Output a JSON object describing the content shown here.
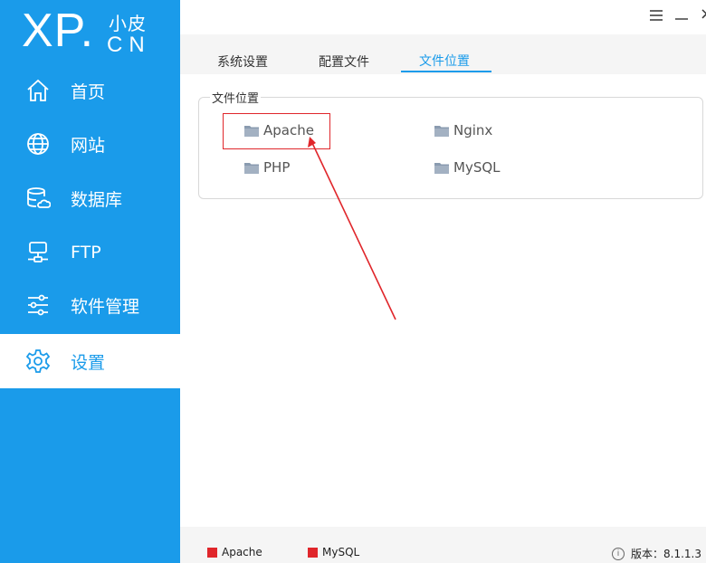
{
  "logo": {
    "main": "XP",
    "dot": ".",
    "top": "小皮",
    "bottom": "CN"
  },
  "window": {
    "menu_icon": "hamburger-icon",
    "minimize_icon": "minimize-icon",
    "close_label": "×"
  },
  "sidebar": {
    "items": [
      {
        "label": "首页",
        "icon": "home-icon"
      },
      {
        "label": "网站",
        "icon": "globe-icon"
      },
      {
        "label": "数据库",
        "icon": "database-icon"
      },
      {
        "label": "FTP",
        "icon": "ftp-icon"
      },
      {
        "label": "软件管理",
        "icon": "sliders-icon"
      },
      {
        "label": "设置",
        "icon": "gear-icon",
        "active": true
      }
    ],
    "colors": {
      "background": "#1a9bea",
      "active_bg": "#ffffff"
    }
  },
  "tabs": [
    {
      "label": "系统设置"
    },
    {
      "label": "配置文件"
    },
    {
      "label": "文件位置",
      "active": true
    }
  ],
  "file_locations": {
    "legend": "文件位置",
    "items": [
      {
        "label": "Apache",
        "icon": "folder-icon"
      },
      {
        "label": "Nginx",
        "icon": "folder-icon"
      },
      {
        "label": "PHP",
        "icon": "folder-icon"
      },
      {
        "label": "MySQL",
        "icon": "folder-icon"
      }
    ]
  },
  "footer": {
    "services": [
      {
        "label": "Apache",
        "status_color": "#e0262b"
      },
      {
        "label": "MySQL",
        "status_color": "#e0262b"
      }
    ],
    "version_label": "版本：8.1.1.3"
  }
}
